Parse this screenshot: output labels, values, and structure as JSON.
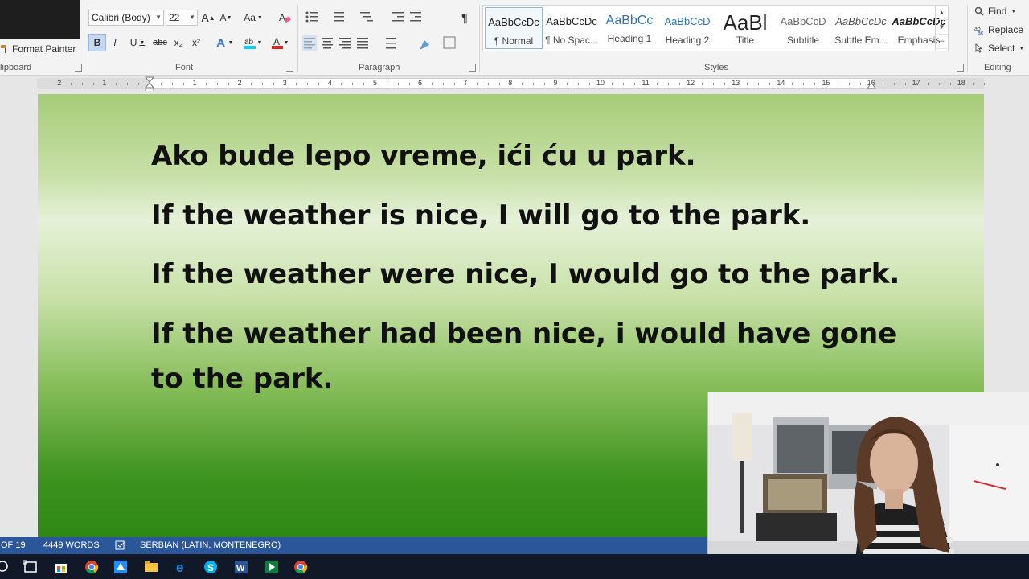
{
  "ribbon": {
    "clipboard": {
      "format_painter": "Format Painter",
      "group_label": "lipboard"
    },
    "font": {
      "font_name": "Calibri (Body)",
      "font_size": "22",
      "grow": "A",
      "shrink": "A",
      "change_case": "Aa",
      "bold": "B",
      "italic": "I",
      "underline": "U",
      "strikethrough": "abc",
      "subscript": "x₂",
      "superscript": "x²",
      "group_label": "Font"
    },
    "paragraph": {
      "group_label": "Paragraph",
      "pilcrow": "¶"
    },
    "styles": {
      "group_label": "Styles",
      "items": [
        {
          "preview": "AaBbCcDc",
          "name": "¶ Normal"
        },
        {
          "preview": "AaBbCcDc",
          "name": "¶ No Spac..."
        },
        {
          "preview": "AaBbCc",
          "name": "Heading 1"
        },
        {
          "preview": "AaBbCcD",
          "name": "Heading 2"
        },
        {
          "preview": "AaBl",
          "name": "Title"
        },
        {
          "preview": "AaBbCcD",
          "name": "Subtitle"
        },
        {
          "preview": "AaBbCcDc",
          "name": "Subtle Em..."
        },
        {
          "preview": "AaBbCcDc",
          "name": "Emphasis"
        }
      ]
    },
    "editing": {
      "group_label": "Editing",
      "find": "Find",
      "replace": "Replace",
      "select": "Select"
    }
  },
  "ruler": {
    "labels": [
      "2",
      "1",
      "1",
      "2",
      "3",
      "4",
      "5",
      "6",
      "7",
      "8",
      "9",
      "10",
      "11",
      "12",
      "13",
      "14",
      "15",
      "16",
      "17",
      "18"
    ]
  },
  "document": {
    "lines": [
      "Ako bude lepo vreme, ići ću u park.",
      "If the weather is nice, I will go to the park.",
      "If the weather were nice,  I would go to the park.",
      "If the weather had been nice, i would have gone",
      "to the park."
    ]
  },
  "status_bar": {
    "page": "OF 19",
    "words": "4449 WORDS",
    "language": "SERBIAN (LATIN, MONTENEGRO)"
  },
  "taskbar": {
    "icons": [
      "search-icon",
      "task-view-icon",
      "store-icon",
      "chrome-icon",
      "app-icon",
      "file-explorer-icon",
      "edge-icon",
      "skype-icon",
      "word-icon",
      "media-app-icon",
      "chrome-icon"
    ]
  },
  "colors": {
    "status_bar": "#2b579a",
    "page_top": "#a6cc78",
    "page_bottom": "#2d8614",
    "taskbar": "#111827"
  }
}
